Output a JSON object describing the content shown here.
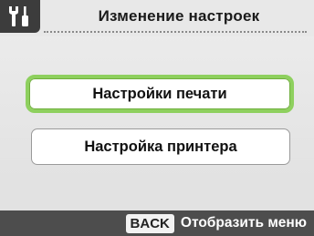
{
  "header": {
    "title": "Изменение настроек",
    "icon": "settings-tools-icon"
  },
  "menu": {
    "items": [
      {
        "label": "Настройки печати",
        "selected": true
      },
      {
        "label": "Настройка принтера",
        "selected": false
      }
    ]
  },
  "footer": {
    "back_key": "BACK",
    "hint": "Отобразить меню"
  },
  "colors": {
    "selection_border": "#8ed05e",
    "footer_bg": "#4d4d4d",
    "icon_bg": "#3c3c3c"
  }
}
